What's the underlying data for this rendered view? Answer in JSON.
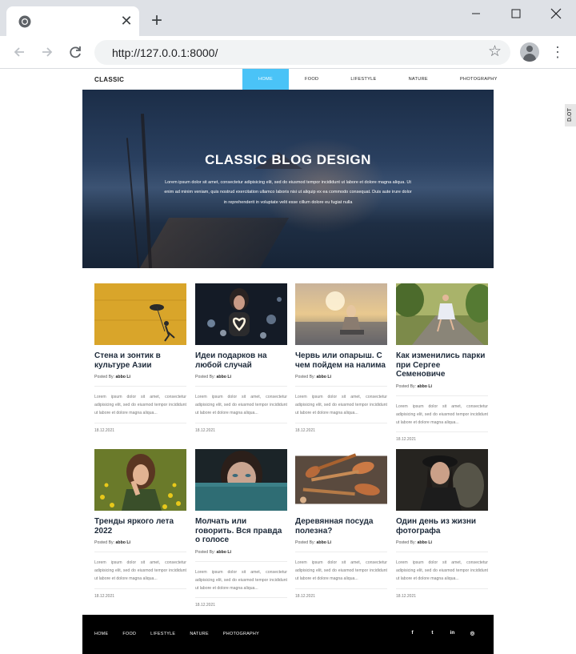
{
  "browser": {
    "url": "http://127.0.0.1:8000/",
    "new_tab_glyph": "+",
    "close_glyph": "✕",
    "window_controls": [
      "minimize",
      "maximize",
      "close"
    ]
  },
  "site": {
    "logo": "CLASSIC",
    "menu": [
      "HOME",
      "FOOD",
      "LIFESTYLE",
      "NATURE",
      "PHOTOGRAPHY"
    ],
    "active_menu": "HOME",
    "accent_color": "#4ac3f7",
    "side_tab": "D.OT"
  },
  "hero": {
    "title": "CLASSIC BLOG DESIGN",
    "text": "Lorem ipsum dolor sit amet, consectetur adipisicing elit, sed do eiusmod tempor incididunt ut labore et dolore magna aliqua. Ut enim ad minim veniam, quis nostrud exercitation ullamco laboris nisi ut aliquip ex ea commodo consequat. Duis aute irure dolor in reprehenderit in voluptate velit esse cillum dolore eu fugiat nulla"
  },
  "posts": [
    {
      "title": "Стена и зонтик в культуре Азии",
      "posted_by": "Posted By:",
      "author": "abbo Li",
      "excerpt": "Lorem ipsum dolor sit amet, consectetur adipisicing elit, sed do eiusmod tempor incididunt ut labore et dolore magna aliqua...",
      "date": "18.12.2021",
      "image": "yellow-wall-umbrella"
    },
    {
      "title": "Идеи подарков на любой случай",
      "posted_by": "Posted By:",
      "author": "abbo Li",
      "excerpt": "Lorem ipsum dolor sit amet, consectetur adipisicing elit, sed do eiusmod tempor incididunt ut labore et dolore magna aliqua...",
      "date": "18.12.2021",
      "image": "girl-heart-lights"
    },
    {
      "title": "Червь или опарыш. С чем пойдем на налима",
      "posted_by": "Posted By:",
      "author": "abbo Li",
      "excerpt": "Lorem ipsum dolor sit amet, consectetur adipisicing elit, sed do eiusmod tempor incididunt ut labore et dolore magna aliqua...",
      "date": "18.12.2021",
      "image": "girl-sunset-lake"
    },
    {
      "title": "Как изменились парки при Сергее Семеновиче",
      "posted_by": "Posted By:",
      "author": "abbo Li",
      "excerpt": "Lorem ipsum dolor sit amet, consectetur adipisicing elit, sed do eiusmod tempor incididunt ut labore et dolore magna aliqua...",
      "date": "18.12.2021",
      "image": "girl-park-path"
    },
    {
      "title": "Тренды яркого лета 2022",
      "posted_by": "Posted By:",
      "author": "abbo Li",
      "excerpt": "Lorem ipsum dolor sit amet, consectetur adipisicing elit, sed do eiusmod tempor incididunt ut labore et dolore magna aliqua...",
      "date": "18.12.2021",
      "image": "woman-flowers"
    },
    {
      "title": "Молчать или говорить. Вся правда о голосе",
      "posted_by": "Posted By:",
      "author": "abbo Li",
      "excerpt": "Lorem ipsum dolor sit amet, consectetur adipisicing elit, sed do eiusmod tempor incididunt ut labore et dolore magna aliqua...",
      "date": "18.12.2021",
      "image": "woman-eyes-scarf"
    },
    {
      "title": "Деревянная посуда полезна?",
      "posted_by": "Posted By:",
      "author": "abbo Li",
      "excerpt": "Lorem ipsum dolor sit amet, consectetur adipisicing elit, sed do eiusmod tempor incididunt ut labore et dolore magna aliqua...",
      "date": "18.12.2021",
      "image": "wooden-spoons"
    },
    {
      "title": "Один день из жизни фотографа",
      "posted_by": "Posted By:",
      "author": "abbo Li",
      "excerpt": "Lorem ipsum dolor sit amet, consectetur adipisicing elit, sed do eiusmod tempor incididunt ut labore et dolore magna aliqua...",
      "date": "18.12.2021",
      "image": "woman-hat-smiling"
    }
  ],
  "footer": {
    "menu": [
      "HOME",
      "FOOD",
      "LIFESTYLE",
      "NATURE",
      "PHOTOGRAPHY"
    ],
    "social": [
      {
        "icon": "facebook-icon",
        "glyph": "f"
      },
      {
        "icon": "twitter-icon",
        "glyph": "t"
      },
      {
        "icon": "linkedin-icon",
        "glyph": "in"
      },
      {
        "icon": "dribbble-icon",
        "glyph": "◎"
      }
    ]
  }
}
